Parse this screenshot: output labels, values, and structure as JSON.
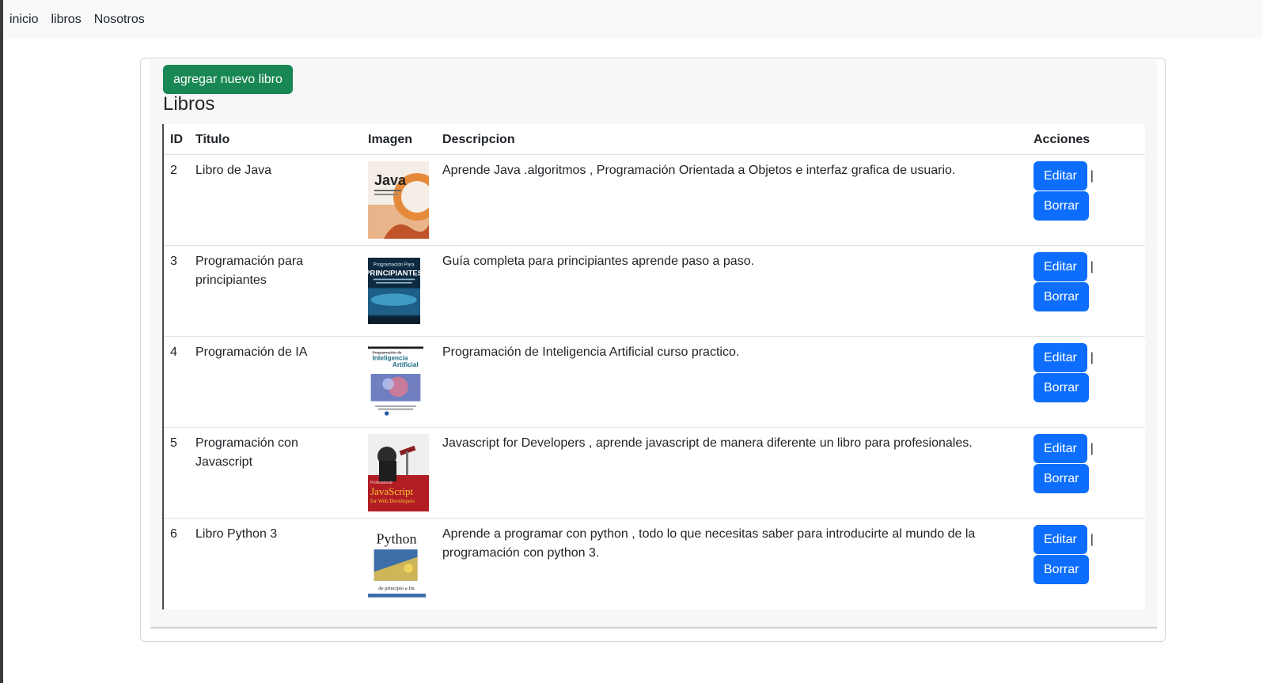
{
  "nav": {
    "items": [
      "inicio",
      "libros",
      "Nosotros"
    ]
  },
  "page": {
    "add_button": "agregar nuevo libro",
    "title": "Libros"
  },
  "table": {
    "headers": {
      "id": "ID",
      "title": "Titulo",
      "image": "Imagen",
      "description": "Descripcion",
      "actions": "Acciones"
    },
    "rows": [
      {
        "id": "2",
        "title": "Libro de Java",
        "description": "Aprende Java .algoritmos , Programación Orientada a Objetos e interfaz grafica de usuario.",
        "cover_text": "Java"
      },
      {
        "id": "3",
        "title": "Programación para principiantes",
        "description": "Guía completa para principiantes aprende paso a paso.",
        "cover_text": "Programación Para PRINCIPIANTES"
      },
      {
        "id": "4",
        "title": "Programación de IA",
        "description": "Programación de Inteligencia Artificial curso practico.",
        "cover_text": "Programación de Inteligencia Artificial"
      },
      {
        "id": "5",
        "title": "Programación con Javascript",
        "description": "Javascript for Developers , aprende javascript de manera diferente un libro para profesionales.",
        "cover_text": "JavaScript for Web Developers"
      },
      {
        "id": "6",
        "title": "Libro Python 3",
        "description": "Aprende a programar con python , todo lo que necesitas saber para introducirte al mundo de la programación con python 3.",
        "cover_text": "Python"
      }
    ],
    "edit_label": "Editar",
    "delete_label": "Borrar",
    "separator": "|"
  },
  "colors": {
    "primary": "#0d6efd",
    "success": "#198754",
    "navbar_bg": "#f8f9fa"
  }
}
